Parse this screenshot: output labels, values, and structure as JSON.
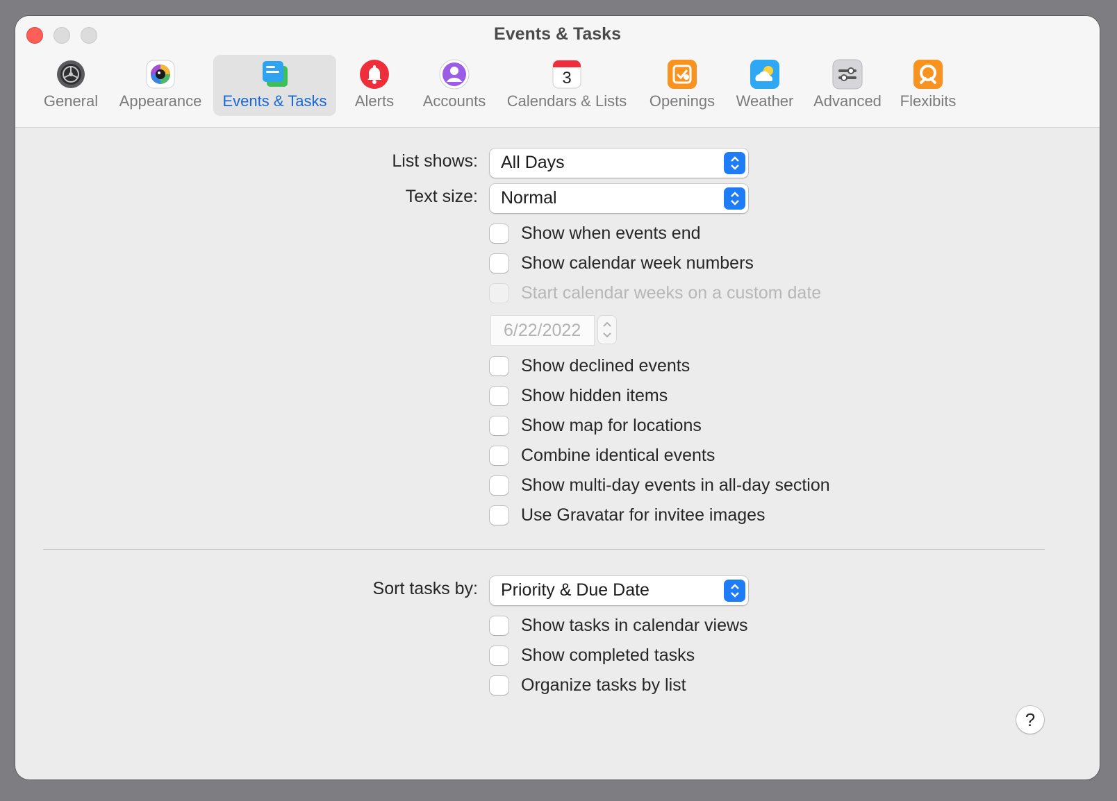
{
  "window": {
    "title": "Events & Tasks"
  },
  "tabs": [
    {
      "label": "General",
      "icon": "gear-icon"
    },
    {
      "label": "Appearance",
      "icon": "color-wheel-icon"
    },
    {
      "label": "Events & Tasks",
      "icon": "events-tasks-icon",
      "active": true
    },
    {
      "label": "Alerts",
      "icon": "bell-icon"
    },
    {
      "label": "Accounts",
      "icon": "person-icon"
    },
    {
      "label": "Calendars & Lists",
      "icon": "calendar-icon",
      "calendar_day": "3"
    },
    {
      "label": "Openings",
      "icon": "openings-icon"
    },
    {
      "label": "Weather",
      "icon": "weather-icon"
    },
    {
      "label": "Advanced",
      "icon": "sliders-icon"
    },
    {
      "label": "Flexibits",
      "icon": "flexibits-icon"
    }
  ],
  "events": {
    "list_shows_label": "List shows:",
    "list_shows_value": "All Days",
    "text_size_label": "Text size:",
    "text_size_value": "Normal",
    "options": [
      {
        "label": "Show when events end",
        "checked": false
      },
      {
        "label": "Show calendar week numbers",
        "checked": false
      },
      {
        "label": "Start calendar weeks on a custom date",
        "checked": false,
        "disabled": true
      }
    ],
    "custom_date": "6/22/2022",
    "options2": [
      {
        "label": "Show declined events",
        "checked": false
      },
      {
        "label": "Show hidden items",
        "checked": false
      },
      {
        "label": "Show map for locations",
        "checked": false
      },
      {
        "label": "Combine identical events",
        "checked": false
      },
      {
        "label": "Show multi-day events in all-day section",
        "checked": false
      },
      {
        "label": "Use Gravatar for invitee images",
        "checked": false
      }
    ]
  },
  "tasks": {
    "sort_label": "Sort tasks by:",
    "sort_value": "Priority & Due Date",
    "options": [
      {
        "label": "Show tasks in calendar views",
        "checked": false
      },
      {
        "label": "Show completed tasks",
        "checked": false
      },
      {
        "label": "Organize tasks by list",
        "checked": false
      }
    ]
  },
  "help": {
    "label": "?"
  },
  "colors": {
    "accent": "#1f7cf7",
    "close": "#fe5f57",
    "active_tab_text": "#1768d6"
  }
}
